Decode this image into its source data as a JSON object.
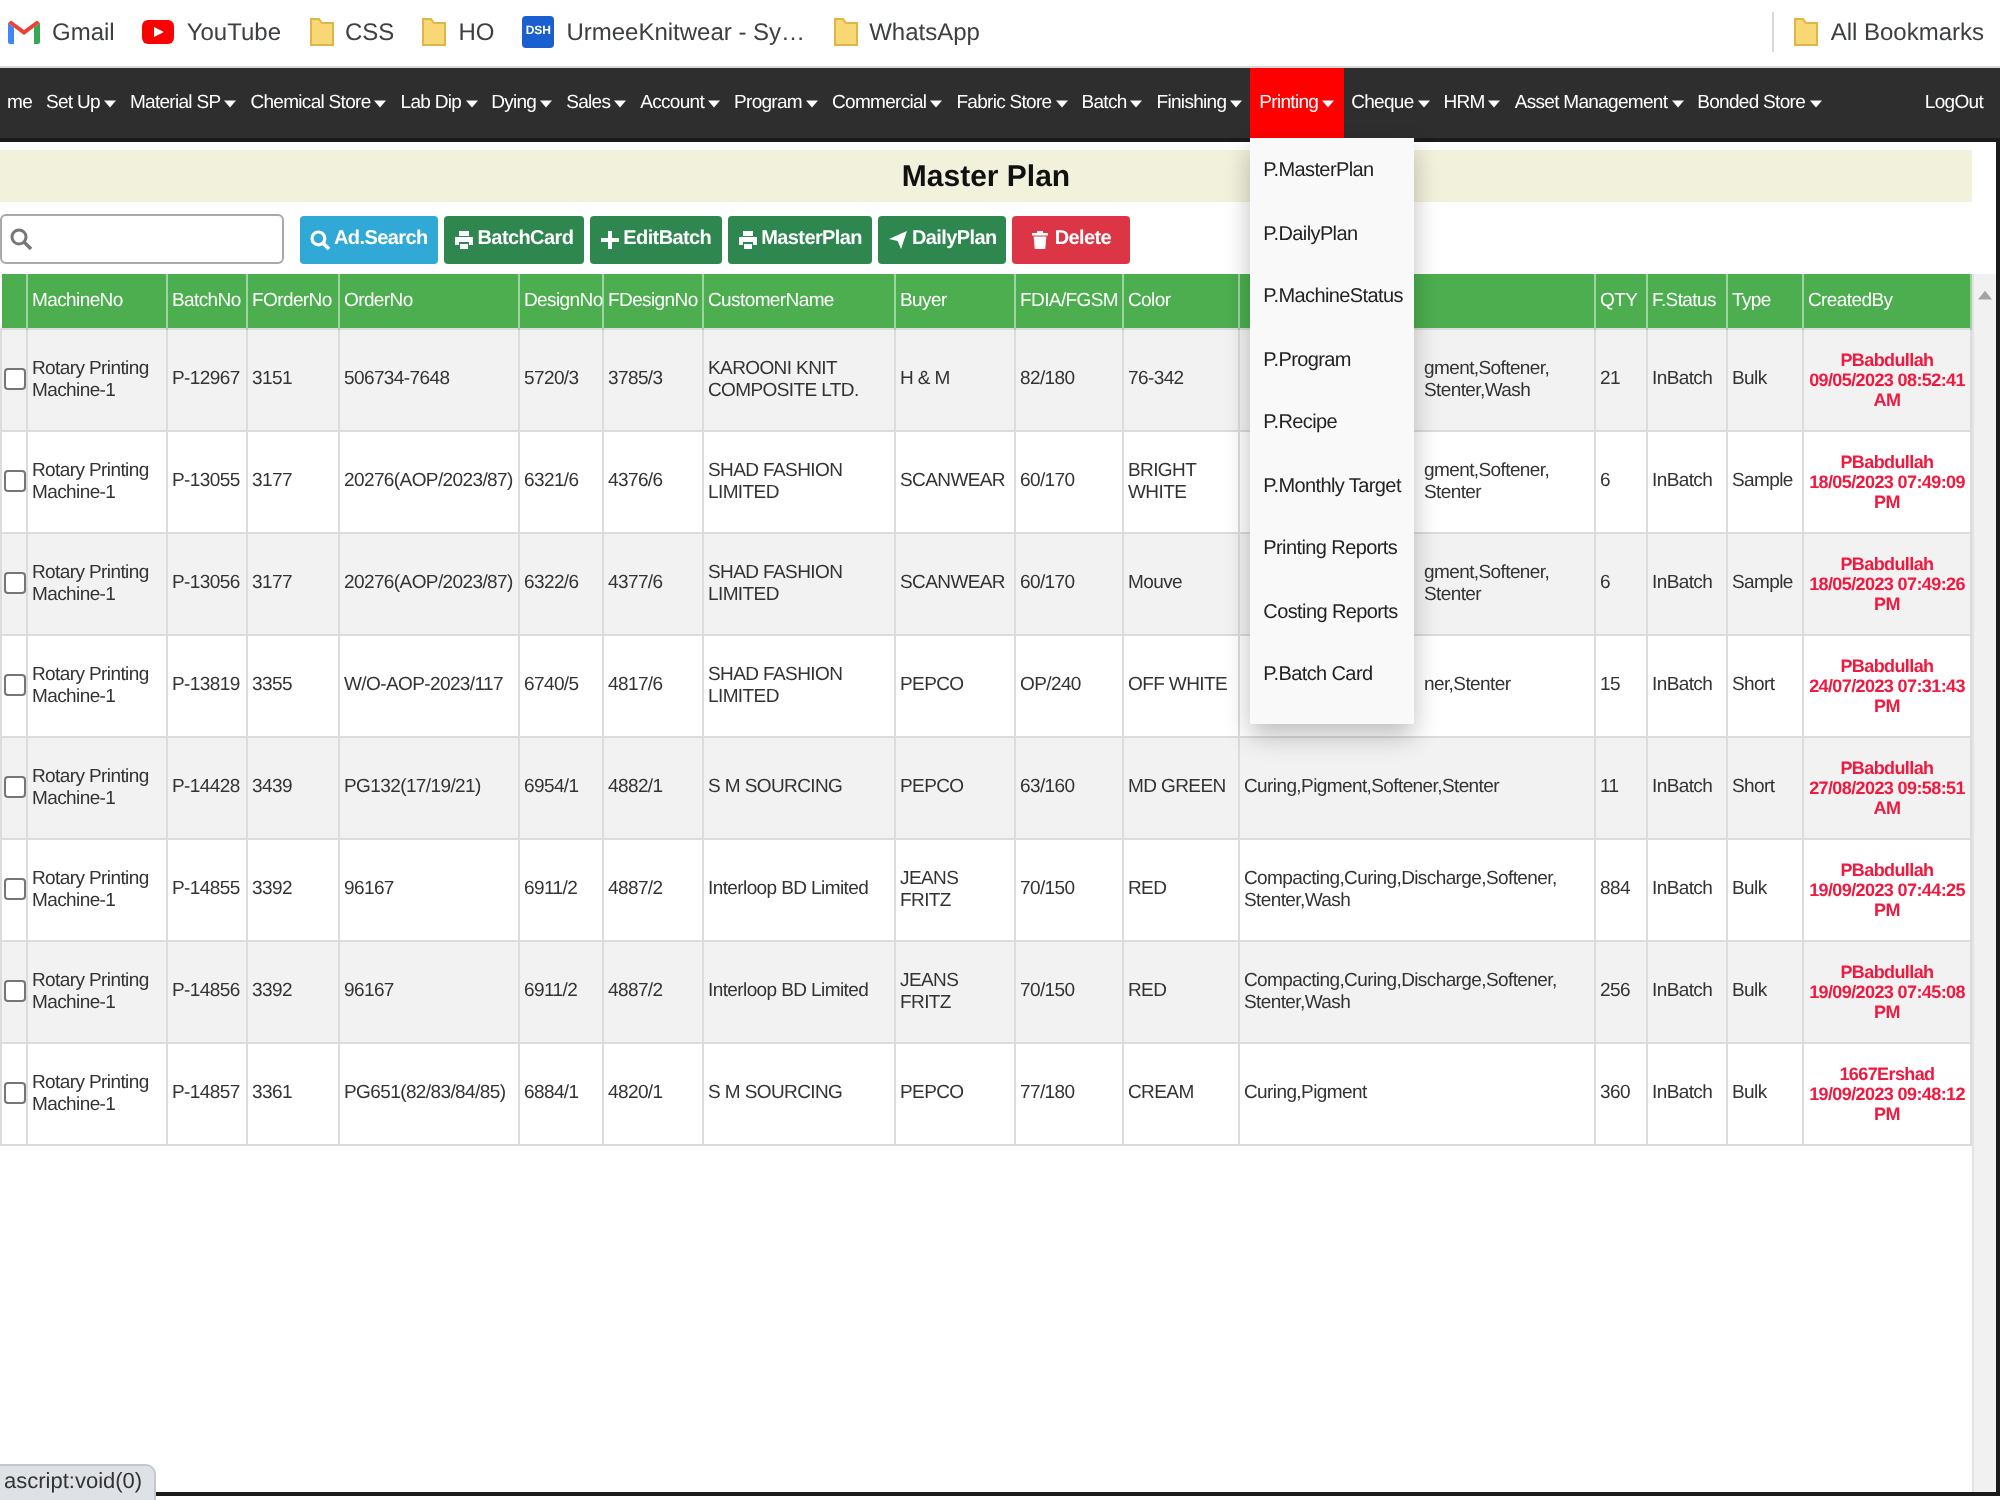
{
  "bookmarks": {
    "items": [
      {
        "label": "Gmail",
        "kind": "mail"
      },
      {
        "label": "YouTube",
        "kind": "video"
      },
      {
        "label": "CSS",
        "kind": "folder"
      },
      {
        "label": "HO",
        "kind": "folder"
      },
      {
        "label": "UrmeeKnitwear - Sy…",
        "kind": "site",
        "badge": "DSH"
      },
      {
        "label": "WhatsApp",
        "kind": "folder"
      }
    ],
    "all_bookmarks": "All Bookmarks"
  },
  "nav": {
    "items": [
      {
        "label": "me",
        "dropdown": false,
        "selected": false
      },
      {
        "label": "Set Up",
        "dropdown": true,
        "selected": false
      },
      {
        "label": "Material SP",
        "dropdown": true,
        "selected": false
      },
      {
        "label": "Chemical Store",
        "dropdown": true,
        "selected": false
      },
      {
        "label": "Lab Dip",
        "dropdown": true,
        "selected": false
      },
      {
        "label": "Dying",
        "dropdown": true,
        "selected": false
      },
      {
        "label": "Sales",
        "dropdown": true,
        "selected": false
      },
      {
        "label": "Account",
        "dropdown": true,
        "selected": false
      },
      {
        "label": "Program",
        "dropdown": true,
        "selected": false
      },
      {
        "label": "Commercial",
        "dropdown": true,
        "selected": false
      },
      {
        "label": "Fabric Store",
        "dropdown": true,
        "selected": false
      },
      {
        "label": "Batch",
        "dropdown": true,
        "selected": false
      },
      {
        "label": "Finishing",
        "dropdown": true,
        "selected": false
      },
      {
        "label": "Printing",
        "dropdown": true,
        "selected": true,
        "menu": [
          "P.MasterPlan",
          "P.DailyPlan",
          "P.MachineStatus",
          "P.Program",
          "P.Recipe",
          "P.Monthly Target",
          "Printing Reports",
          "Costing Reports",
          "P.Batch Card"
        ]
      },
      {
        "label": "Cheque",
        "dropdown": true,
        "selected": false
      },
      {
        "label": "HRM",
        "dropdown": true,
        "selected": false
      },
      {
        "label": "Asset Management",
        "dropdown": true,
        "selected": false
      },
      {
        "label": "Bonded Store",
        "dropdown": true,
        "selected": false
      }
    ],
    "logout": "LogOut"
  },
  "page": {
    "title": "Master Plan"
  },
  "toolbar": {
    "buttons": [
      {
        "label": "Ad.Search",
        "kind": "search"
      },
      {
        "label": "BatchCard",
        "kind": "print"
      },
      {
        "label": "EditBatch",
        "kind": "add"
      },
      {
        "label": "MasterPlan",
        "kind": "print"
      },
      {
        "label": "DailyPlan",
        "kind": "send"
      },
      {
        "label": "Delete",
        "kind": "delete"
      }
    ]
  },
  "table": {
    "columns": [
      "MachineNo",
      "BatchNo",
      "FOrderNo",
      "OrderNo",
      "DesignNo",
      "FDesignNo",
      "CustomerName",
      "Buyer",
      "FDIA/FGSM",
      "Color",
      null,
      "QTY",
      "F.Status",
      "Type",
      "CreatedBy"
    ],
    "rows": [
      {
        "checked": false,
        "machine_no": "Rotary Printing Machine-1",
        "batch_no": "P-12967",
        "f_order_no": "3151",
        "order_no": "506734-7648",
        "design_no": "5720/3",
        "f_design_no": "3785/3",
        "customer_name": "KAROONI KNIT COMPOSITE LTD.",
        "buyer": "H & M",
        "fdia_fgsm": "82/180",
        "color_name": "76-342",
        "column_12": "gment,Softener,Stenter,Wash",
        "column_12_covered": true,
        "qty": "21",
        "f_status": "InBatch",
        "type": "Bulk",
        "created_by": "PBabdullah",
        "created_at": "09/05/2023 08:52:41 AM"
      },
      {
        "checked": false,
        "machine_no": "Rotary Printing Machine-1",
        "batch_no": "P-13055",
        "f_order_no": "3177",
        "order_no": "20276(AOP/2023/87)",
        "design_no": "6321/6",
        "f_design_no": "4376/6",
        "customer_name": "SHAD FASHION LIMITED",
        "buyer": "SCANWEAR",
        "fdia_fgsm": "60/170",
        "color_name": "BRIGHT WHITE",
        "column_12": "gment,Softener,Stenter",
        "column_12_covered": true,
        "qty": "6",
        "f_status": "InBatch",
        "type": "Sample",
        "created_by": "PBabdullah",
        "created_at": "18/05/2023 07:49:09 PM"
      },
      {
        "checked": false,
        "machine_no": "Rotary Printing Machine-1",
        "batch_no": "P-13056",
        "f_order_no": "3177",
        "order_no": "20276(AOP/2023/87)",
        "design_no": "6322/6",
        "f_design_no": "4377/6",
        "customer_name": "SHAD FASHION LIMITED",
        "buyer": "SCANWEAR",
        "fdia_fgsm": "60/170",
        "color_name": "Mouve",
        "column_12": "gment,Softener,Stenter",
        "column_12_covered": true,
        "qty": "6",
        "f_status": "InBatch",
        "type": "Sample",
        "created_by": "PBabdullah",
        "created_at": "18/05/2023 07:49:26 PM"
      },
      {
        "checked": false,
        "machine_no": "Rotary Printing Machine-1",
        "batch_no": "P-13819",
        "f_order_no": "3355",
        "order_no": "W/O-AOP-2023/117",
        "design_no": "6740/5",
        "f_design_no": "4817/6",
        "customer_name": "SHAD FASHION LIMITED",
        "buyer": "PEPCO",
        "fdia_fgsm": "OP/240",
        "color_name": "OFF WHITE",
        "column_12": "ner,Stenter",
        "column_12_covered": true,
        "qty": "15",
        "f_status": "InBatch",
        "type": "Short",
        "created_by": "PBabdullah",
        "created_at": "24/07/2023 07:31:43 PM"
      },
      {
        "checked": false,
        "machine_no": "Rotary Printing Machine-1",
        "batch_no": "P-14428",
        "f_order_no": "3439",
        "order_no": "PG132(17/19/21)",
        "design_no": "6954/1",
        "f_design_no": "4882/1",
        "customer_name": "S M SOURCING",
        "buyer": "PEPCO",
        "fdia_fgsm": "63/160",
        "color_name": "MD GREEN",
        "column_12": "Curing,Pigment,Softener,Stenter",
        "column_12_covered": false,
        "qty": "11",
        "f_status": "InBatch",
        "type": "Short",
        "created_by": "PBabdullah",
        "created_at": "27/08/2023 09:58:51 AM"
      },
      {
        "checked": false,
        "machine_no": "Rotary Printing Machine-1",
        "batch_no": "P-14855",
        "f_order_no": "3392",
        "order_no": "96167",
        "design_no": "6911/2",
        "f_design_no": "4887/2",
        "customer_name": "Interloop BD Limited",
        "buyer": "JEANS FRITZ",
        "fdia_fgsm": "70/150",
        "color_name": "RED",
        "column_12": "Compacting,Curing,Discharge,Softener,Stenter,Wash",
        "column_12_covered": false,
        "qty": "884",
        "f_status": "InBatch",
        "type": "Bulk",
        "created_by": "PBabdullah",
        "created_at": "19/09/2023 07:44:25 PM"
      },
      {
        "checked": false,
        "machine_no": "Rotary Printing Machine-1",
        "batch_no": "P-14856",
        "f_order_no": "3392",
        "order_no": "96167",
        "design_no": "6911/2",
        "f_design_no": "4887/2",
        "customer_name": "Interloop BD Limited",
        "buyer": "JEANS FRITZ",
        "fdia_fgsm": "70/150",
        "color_name": "RED",
        "column_12": "Compacting,Curing,Discharge,Softener,Stenter,Wash",
        "column_12_covered": false,
        "qty": "256",
        "f_status": "InBatch",
        "type": "Bulk",
        "created_by": "PBabdullah",
        "created_at": "19/09/2023 07:45:08 PM"
      },
      {
        "checked": false,
        "machine_no": "Rotary Printing Machine-1",
        "batch_no": "P-14857",
        "f_order_no": "3361",
        "order_no": "PG651(82/83/84/85)",
        "design_no": "6884/1",
        "f_design_no": "4820/1",
        "customer_name": "S M SOURCING",
        "buyer": "PEPCO",
        "fdia_fgsm": "77/180",
        "color_name": "CREAM",
        "column_12": "Curing,Pigment",
        "column_12_covered": false,
        "qty": "360",
        "f_status": "InBatch",
        "type": "Bulk",
        "created_by": "1667Ershad",
        "created_at": "19/09/2023 09:48:12 PM"
      }
    ]
  },
  "status_bar": "ascript:void(0)"
}
